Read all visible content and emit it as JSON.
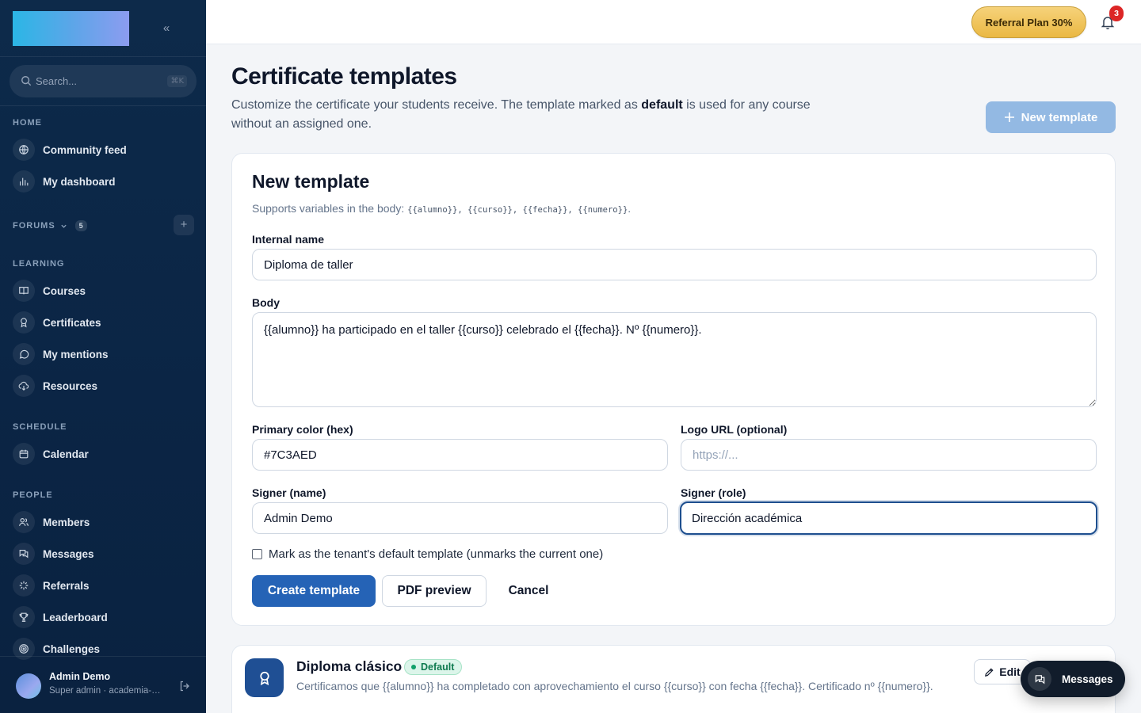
{
  "sidebar": {
    "collapse_glyph": "«",
    "search_placeholder": "Search...",
    "search_shortcut": "⌘K",
    "sections": {
      "home": "HOME",
      "forums": "FORUMS",
      "forums_count": "5",
      "learning": "LEARNING",
      "schedule": "SCHEDULE",
      "people": "PEOPLE"
    },
    "items": {
      "community_feed": "Community feed",
      "my_dashboard": "My dashboard",
      "courses": "Courses",
      "certificates": "Certificates",
      "my_mentions": "My mentions",
      "resources": "Resources",
      "calendar": "Calendar",
      "members": "Members",
      "messages": "Messages",
      "referrals": "Referrals",
      "leaderboard": "Leaderboard",
      "challenges": "Challenges"
    },
    "user": {
      "name": "Admin Demo",
      "role": "Super admin · academia-demo"
    }
  },
  "topbar": {
    "referral_label": "Referral Plan 30%",
    "notification_count": "3"
  },
  "page": {
    "title": "Certificate templates",
    "desc_before": "Customize the certificate your students receive. The template marked as ",
    "desc_bold": "default",
    "desc_after": " is used for any course without an assigned one.",
    "new_template_label": "New template"
  },
  "form": {
    "title": "New template",
    "subtitle_prefix": "Supports variables in the body: ",
    "variables": "{{alumno}}, {{curso}}, {{fecha}}, {{numero}}",
    "subtitle_suffix": ".",
    "internal_name_label": "Internal name",
    "internal_name_value": "Diploma de taller",
    "body_label": "Body",
    "body_value": "{{alumno}} ha participado en el taller {{curso}} celebrado el {{fecha}}. Nº {{numero}}.",
    "primary_color_label": "Primary color (hex)",
    "primary_color_value": "#7C3AED",
    "logo_url_label": "Logo URL (optional)",
    "logo_url_placeholder": "https://...",
    "signer_name_label": "Signer (name)",
    "signer_name_value": "Admin Demo",
    "signer_role_label": "Signer (role)",
    "signer_role_value": "Dirección académica",
    "default_checkbox_label": "Mark as the tenant's default template (unmarks the current one)",
    "create_label": "Create template",
    "preview_label": "PDF preview",
    "cancel_label": "Cancel"
  },
  "templates": [
    {
      "name": "Diploma clásico",
      "badge": "Default",
      "body": "Certificamos que {{alumno}} ha completado con aprovechamiento el curso {{curso}} con fecha {{fecha}}. Certificado nº {{numero}}.",
      "edit_label": "Edit"
    }
  ],
  "fab": {
    "messages_label": "Messages"
  },
  "colors": {
    "sidebar_bg": "#0b2545",
    "primary": "#2563b6",
    "referral_gold": "#eab843",
    "badge_red": "#dc2626",
    "default_green": "#12a06a"
  }
}
